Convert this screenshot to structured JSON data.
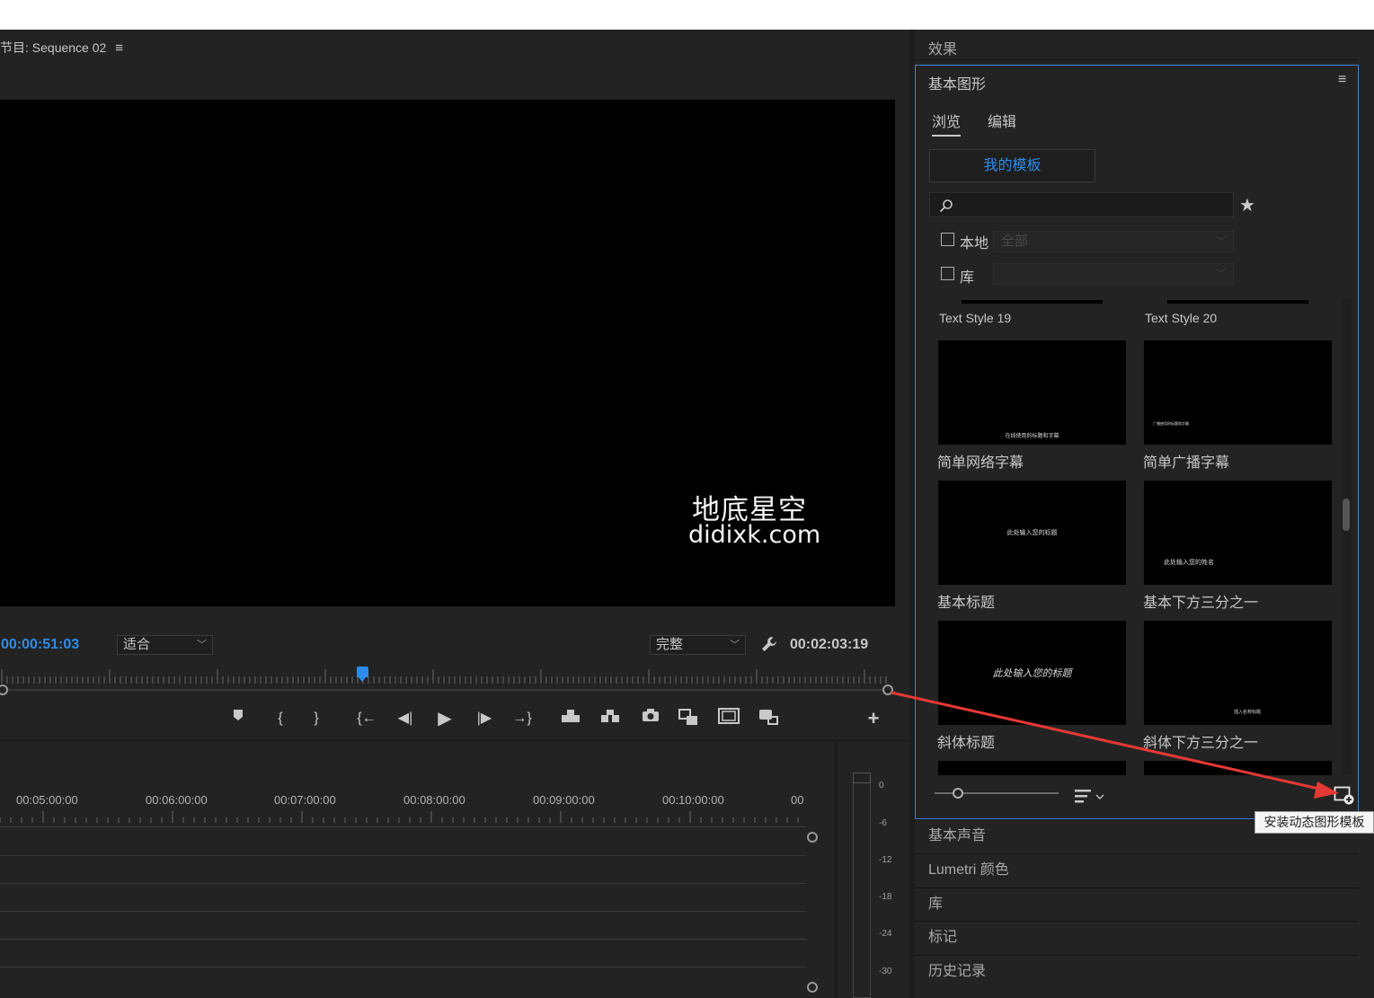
{
  "program_monitor": {
    "title": "节目: Sequence 02",
    "menu_icon": "≡",
    "watermark_line1": "地底星空",
    "watermark_line2": "didixk.com",
    "timecode_current": "00:00:51:03",
    "fit_dropdown": "适合",
    "quality_dropdown": "完整",
    "timecode_duration": "00:02:03:19",
    "add_button": "+"
  },
  "timeline": {
    "ruler_labels": [
      "00:05:00:00",
      "00:06:00:00",
      "00:07:00:00",
      "00:08:00:00",
      "00:09:00:00",
      "00:10:00:00",
      "00"
    ]
  },
  "audio_meter": {
    "labels": [
      "0",
      "-6",
      "-12",
      "-18",
      "-24",
      "-30"
    ]
  },
  "right_panel": {
    "effects_header": "效果",
    "essential_graphics": {
      "title": "基本图形",
      "menu_icon": "≡",
      "tabs": [
        {
          "label": "浏览",
          "active": true
        },
        {
          "label": "编辑",
          "active": false
        }
      ],
      "my_templates_button": "我的模板",
      "search_placeholder": "",
      "filters": [
        {
          "label": "本地",
          "checked": false,
          "select_value": "全部"
        },
        {
          "label": "库",
          "checked": false,
          "select_value": ""
        }
      ],
      "templates": [
        {
          "caption": "Text Style 19",
          "preview_text": ""
        },
        {
          "caption": "Text Style 20",
          "preview_text": ""
        },
        {
          "caption": "简单网络字幕",
          "preview_text": "在线使用的标题和字幕"
        },
        {
          "caption": "简单广播字幕",
          "preview_text": "广播使用的标题和字幕"
        },
        {
          "caption": "基本标题",
          "preview_text": "此处输入您的标题"
        },
        {
          "caption": "基本下方三分之一",
          "preview_text": "此处输入您的姓名"
        },
        {
          "caption": "斜体标题",
          "preview_text": "此处输入您的标题"
        },
        {
          "caption": "斜体下方三分之一",
          "preview_text": "插入名称标题"
        }
      ],
      "install_tooltip": "安装动态图形模板"
    },
    "collapsed_sections": [
      "基本声音",
      "Lumetri 颜色",
      "库",
      "标记",
      "历史记录"
    ]
  },
  "colors": {
    "accent_blue": "#2d8ceb",
    "annotation_red": "#e53935",
    "panel_bg": "#232323",
    "focus_border": "#3a85d3"
  }
}
